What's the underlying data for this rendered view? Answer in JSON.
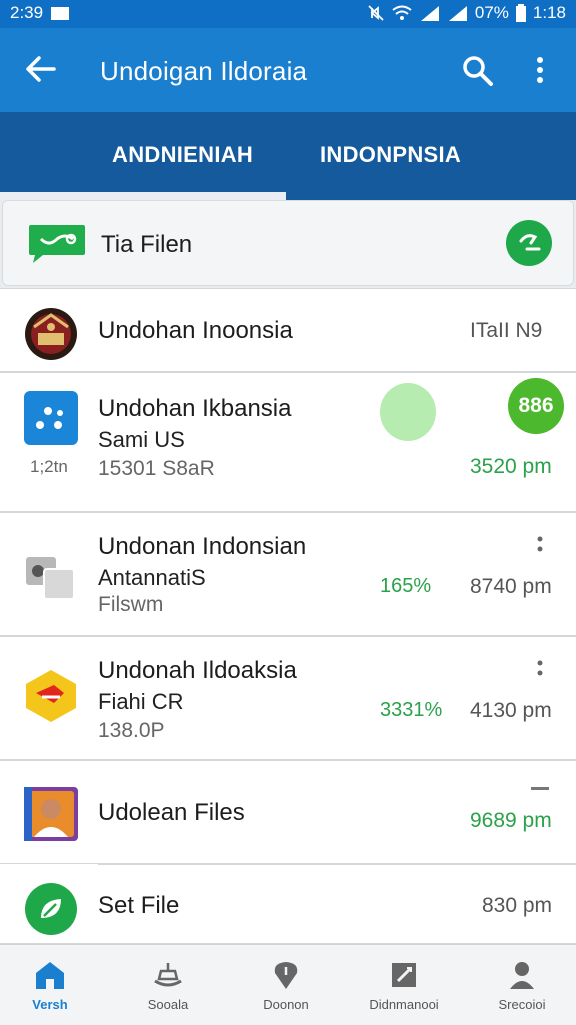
{
  "status_bar": {
    "time_left": "2:39",
    "battery": "07%",
    "time_right": "1:18"
  },
  "app_bar": {
    "title": "Undoigan Ildoraia"
  },
  "tabs": [
    {
      "label": "ANDNIENIAH"
    },
    {
      "label": "INDONPNSIA"
    }
  ],
  "header_card": {
    "label": "Tia Filen"
  },
  "rows": [
    {
      "title": "Undohan Inoonsia",
      "time": "ITaII N9"
    },
    {
      "title": "Undohan Ikbansia",
      "sub": "Sami US",
      "left_meta": "1;2tn",
      "meta": "15301 S8aR",
      "badge": "886",
      "time": "3520 pm"
    },
    {
      "title": "Undonan Indonsian",
      "sub": "AntannatiS",
      "meta": "Filswm",
      "percent": "165%",
      "time": "8740 pm"
    },
    {
      "title": "Undonah Ildoaksia",
      "sub": "Fiahi CR",
      "meta": "138.0P",
      "percent": "3331%",
      "time": "4130 pm"
    },
    {
      "title": "Udolean Files",
      "time": "9689 pm"
    },
    {
      "title": "Set File",
      "time": "830 pm"
    }
  ],
  "bottom_nav": [
    {
      "label": "Versh"
    },
    {
      "label": "Sooala"
    },
    {
      "label": "Doonon"
    },
    {
      "label": "Didnmanooi"
    },
    {
      "label": "Srecoioi"
    }
  ],
  "colors": {
    "primary": "#1b7fd0",
    "tab_bar": "#145a9c",
    "accent_green": "#2aa14a"
  }
}
